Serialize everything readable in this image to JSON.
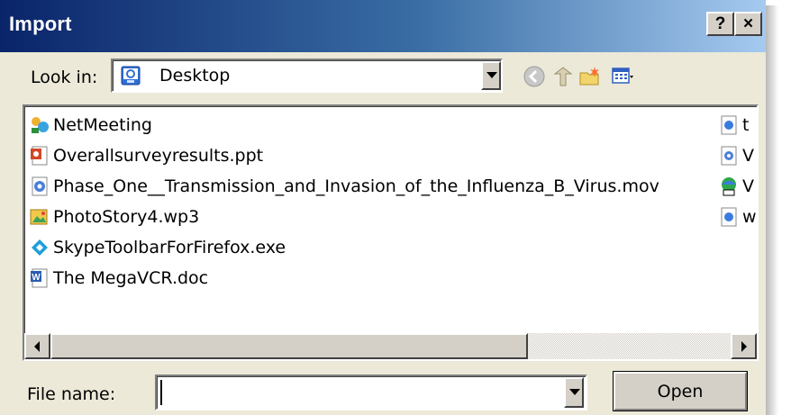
{
  "window": {
    "title": "Import",
    "help_label": "?",
    "close_label": "×"
  },
  "lookin": {
    "label": "Look in:",
    "value": "Desktop",
    "icon": "desktop-icon"
  },
  "toolbar": {
    "back_icon": "back-icon",
    "up_icon": "up-folder-icon",
    "new_folder_icon": "new-folder-icon",
    "views_icon": "views-menu-icon"
  },
  "files": [
    {
      "name": "NetMeeting",
      "icon": "netmeeting-icon"
    },
    {
      "name": "Overallsurveyresults.ppt",
      "icon": "powerpoint-file-icon"
    },
    {
      "name": "Phase_One__Transmission_and_Invasion_of_the_Influenza_B_Virus.mov",
      "icon": "video-file-icon"
    },
    {
      "name": "PhotoStory4.wp3",
      "icon": "photostory-file-icon"
    },
    {
      "name": "SkypeToolbarForFirefox.exe",
      "icon": "exe-file-icon"
    },
    {
      "name": "The MegaVCR.doc",
      "icon": "word-document-icon"
    }
  ],
  "files_col2": [
    {
      "name": "t",
      "icon": "shortcut-icon"
    },
    {
      "name": "V",
      "icon": "video-file-icon"
    },
    {
      "name": "V",
      "icon": "network-icon"
    },
    {
      "name": "w",
      "icon": "shortcut-icon"
    }
  ],
  "filename": {
    "label": "File name:",
    "value": ""
  },
  "buttons": {
    "open_label": "Open"
  },
  "colors": {
    "titlebar_start": "#0a246a",
    "titlebar_end": "#a6caf0",
    "face": "#ece9d8"
  }
}
